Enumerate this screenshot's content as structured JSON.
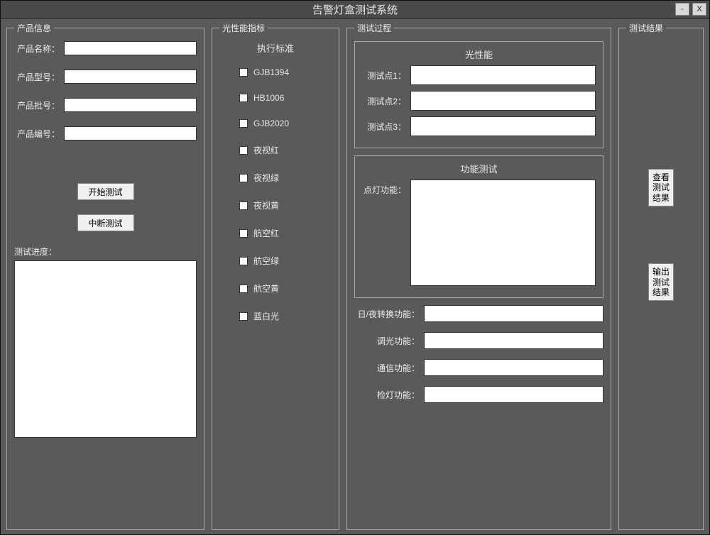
{
  "window": {
    "title": "告警灯盒测试系统",
    "minimize": "-",
    "close": "X"
  },
  "groups": {
    "product": "产品信息",
    "optics": "光性能指标",
    "process": "测试过程",
    "result": "测试结果"
  },
  "product": {
    "name_label": "产品名称：",
    "model_label": "产品型号：",
    "batch_label": "产品批号：",
    "serial_label": "产品编号：",
    "name": "",
    "model": "",
    "batch": "",
    "serial": "",
    "start_btn": "开始测试",
    "stop_btn": "中断测试",
    "progress_label": "测试进度：",
    "progress": ""
  },
  "optics": {
    "std_title": "执行标准",
    "items": [
      "GJB1394",
      "HB1006",
      "GJB2020",
      "夜视红",
      "夜视绿",
      "夜视黄",
      "航空红",
      "航空绿",
      "航空黄",
      "蓝白光"
    ]
  },
  "process": {
    "opt_title": "光性能",
    "tp1_label": "测试点1：",
    "tp2_label": "测试点2：",
    "tp3_label": "测试点3：",
    "tp1": "",
    "tp2": "",
    "tp3": "",
    "func_title": "功能测试",
    "lamp_label": "点灯功能：",
    "lamp": "",
    "daynight_label": "日/夜转换功能：",
    "dim_label": "调光功能：",
    "comm_label": "通信功能：",
    "check_label": "检灯功能：",
    "daynight": "",
    "dim": "",
    "comm": "",
    "check": ""
  },
  "result": {
    "view_btn": "查看测试结果",
    "export_btn": "输出测试结果"
  }
}
